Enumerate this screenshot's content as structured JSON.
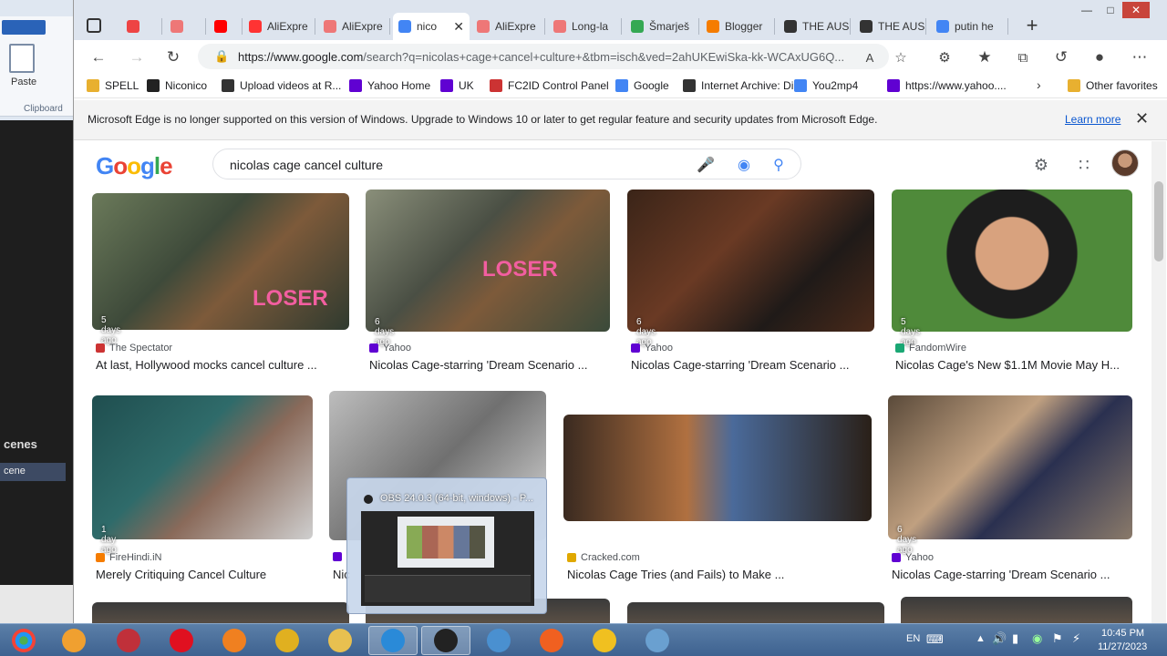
{
  "background_app": {
    "paste_label": "Paste",
    "clipboard_label": "Clipboard",
    "scenes_label": "cenes",
    "scene_item": "cene"
  },
  "browser": {
    "tabs": [
      {
        "label": "",
        "color": "#e44"
      },
      {
        "label": "",
        "color": "#e77"
      },
      {
        "label": "",
        "color": "#f00"
      },
      {
        "label": "AliExpre",
        "color": "#f33"
      },
      {
        "label": "AliExpre",
        "color": "#e77"
      },
      {
        "label": "nico",
        "color": "#4285f4",
        "active": true
      },
      {
        "label": "AliExpre",
        "color": "#e77"
      },
      {
        "label": "Long-la",
        "color": "#e77"
      },
      {
        "label": "Šmarješ",
        "color": "#34a853"
      },
      {
        "label": "Blogger",
        "color": "#f57c00"
      },
      {
        "label": "THE AUS",
        "color": "#333"
      },
      {
        "label": "THE AUS",
        "color": "#333"
      },
      {
        "label": "putin he",
        "color": "#4285f4"
      }
    ],
    "url_host": "https://www.google.com",
    "url_rest": "/search?q=nicolas+cage+cancel+culture+&tbm=isch&ved=2ahUKEwiSka-kk-WCAxUG6Q...",
    "bookmarks": [
      {
        "label": "SPELL",
        "color": "#e8b030"
      },
      {
        "label": "Niconico",
        "color": "#222"
      },
      {
        "label": "Upload videos at R...",
        "color": "#333"
      },
      {
        "label": "Yahoo Home",
        "color": "#6001d2"
      },
      {
        "label": "UK",
        "color": "#6001d2"
      },
      {
        "label": "FC2ID Control Panel",
        "color": "#c33"
      },
      {
        "label": "Google",
        "color": "#4285f4"
      },
      {
        "label": "Internet Archive: Di...",
        "color": "#333"
      },
      {
        "label": "You2mp4",
        "color": "#4285f4"
      },
      {
        "label": "https://www.yahoo....",
        "color": "#6001d2"
      }
    ],
    "other_favorites": "Other favorites",
    "infobar_message": "Microsoft Edge is no longer supported on this version of Windows. Upgrade to Windows 10 or later to get regular feature and security updates from Microsoft Edge.",
    "learn_more": "Learn more"
  },
  "google": {
    "query": "nicolas cage cancel culture",
    "results": [
      {
        "age": "5 days ago",
        "source": "The Spectator",
        "source_color": "#c33",
        "title": "At last, Hollywood mocks cancel culture ..."
      },
      {
        "age": "6 days ago",
        "source": "Yahoo",
        "source_color": "#6001d2",
        "title": "Nicolas Cage-starring 'Dream Scenario ..."
      },
      {
        "age": "6 days ago",
        "source": "Yahoo",
        "source_color": "#6001d2",
        "title": "Nicolas Cage-starring 'Dream Scenario ..."
      },
      {
        "age": "5 days ago",
        "source": "FandomWire",
        "source_color": "#1aa774",
        "title": "Nicolas Cage's New $1.1M Movie May H..."
      },
      {
        "age": "1 day ago",
        "source": "FireHindi.iN",
        "source_color": "#f57c00",
        "title": "Merely Critiquing Cancel Culture"
      },
      {
        "age": "",
        "source": "",
        "source_color": "#6001d2",
        "title": "Nic"
      },
      {
        "age": "",
        "source": "Cracked.com",
        "source_color": "#e0a800",
        "title": "Nicolas Cage Tries (and Fails) to Make ..."
      },
      {
        "age": "6 days ago",
        "source": "Yahoo",
        "source_color": "#6001d2",
        "title": "Nicolas Cage-starring 'Dream Scenario ..."
      }
    ],
    "loser_text": "LOSER"
  },
  "preview": {
    "title": "OBS 24.0.3 (64-bit, windows) - P..."
  },
  "tray": {
    "lang": "EN",
    "time": "10:45 PM",
    "date": "11/27/2023"
  }
}
